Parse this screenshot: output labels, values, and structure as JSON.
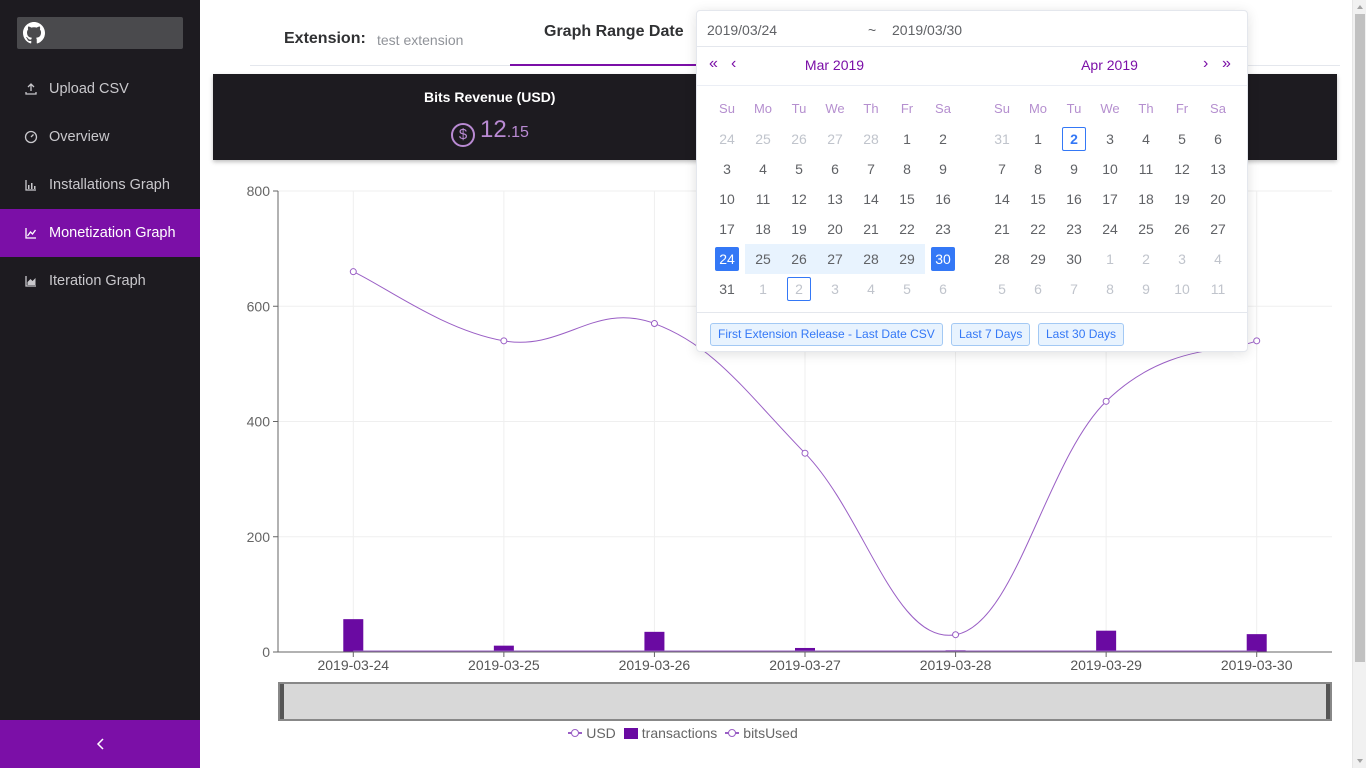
{
  "sidebar": {
    "items": [
      {
        "label": "Upload CSV",
        "icon": "upload-icon"
      },
      {
        "label": "Overview",
        "icon": "dashboard-icon"
      },
      {
        "label": "Installations Graph",
        "icon": "bar-chart-icon"
      },
      {
        "label": "Monetization Graph",
        "icon": "line-chart-icon",
        "active": true
      },
      {
        "label": "Iteration Graph",
        "icon": "area-chart-icon"
      }
    ],
    "collapse_icon": "chevron-left-icon"
  },
  "header": {
    "extension_label": "Extension:",
    "extension_value": "test extension",
    "tab_label": "Graph Range Date"
  },
  "stats": {
    "title": "Bits Revenue (USD)",
    "value_int": "12",
    "value_cents": ".15",
    "currency_symbol": "$"
  },
  "datepicker": {
    "start": "2019/03/24",
    "separator": "~",
    "end": "2019/03/30",
    "nav": {
      "prev_year": "«",
      "prev_month": "‹",
      "next_month": "›",
      "next_year": "»"
    },
    "weekdays": [
      "Su",
      "Mo",
      "Tu",
      "We",
      "Th",
      "Fr",
      "Sa"
    ],
    "left": {
      "title": "Mar 2019",
      "days": [
        [
          "24",
          "25",
          "26",
          "27",
          "28",
          "1",
          "2"
        ],
        [
          "3",
          "4",
          "5",
          "6",
          "7",
          "8",
          "9"
        ],
        [
          "10",
          "11",
          "12",
          "13",
          "14",
          "15",
          "16"
        ],
        [
          "17",
          "18",
          "19",
          "20",
          "21",
          "22",
          "23"
        ],
        [
          "24",
          "25",
          "26",
          "27",
          "28",
          "29",
          "30"
        ],
        [
          "31",
          "1",
          "2",
          "3",
          "4",
          "5",
          "6"
        ]
      ]
    },
    "right": {
      "title": "Apr 2019",
      "days": [
        [
          "31",
          "1",
          "2",
          "3",
          "4",
          "5",
          "6"
        ],
        [
          "7",
          "8",
          "9",
          "10",
          "11",
          "12",
          "13"
        ],
        [
          "14",
          "15",
          "16",
          "17",
          "18",
          "19",
          "20"
        ],
        [
          "21",
          "22",
          "23",
          "24",
          "25",
          "26",
          "27"
        ],
        [
          "28",
          "29",
          "30",
          "1",
          "2",
          "3",
          "4"
        ],
        [
          "5",
          "6",
          "7",
          "8",
          "9",
          "10",
          "11"
        ]
      ]
    },
    "shortcuts": [
      "First Extension Release - Last Date CSV",
      "Last 7 Days",
      "Last 30 Days"
    ]
  },
  "colors": {
    "accent": "#7b0fa7",
    "sidebar_bg": "#1d1b20",
    "usd_line": "#9a5fc5",
    "transactions_bar": "#6a0aa2",
    "selected_day": "#3478f6"
  },
  "chart_data": {
    "type": "bar",
    "categories": [
      "2019-03-24",
      "2019-03-25",
      "2019-03-26",
      "2019-03-27",
      "2019-03-28",
      "2019-03-29",
      "2019-03-30"
    ],
    "ylim": [
      0,
      800
    ],
    "yticks": [
      0,
      200,
      400,
      600,
      800
    ],
    "series": [
      {
        "name": "USD",
        "type": "line",
        "values": [
          null,
          null,
          null,
          null,
          null,
          null,
          null
        ]
      },
      {
        "name": "transactions",
        "type": "bar",
        "values": [
          57,
          11,
          35,
          7,
          3,
          37,
          31
        ]
      },
      {
        "name": "bitsUsed",
        "type": "line",
        "smooth": true,
        "values": [
          660,
          540,
          570,
          345,
          30,
          435,
          540
        ]
      }
    ],
    "legend_position": "bottom",
    "grid": true
  }
}
